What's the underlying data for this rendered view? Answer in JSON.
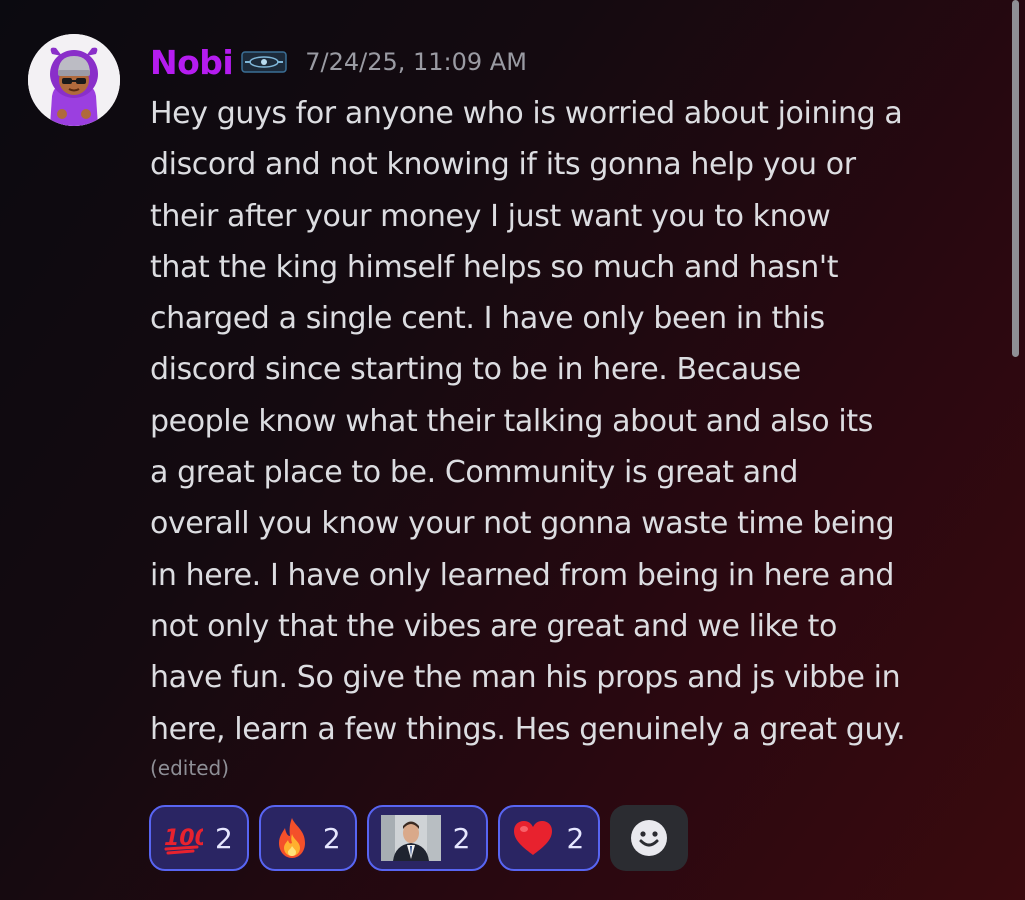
{
  "message": {
    "author": "Nobi",
    "timestamp": "7/24/25, 11:09 AM",
    "lines": [
      "Hey guys for anyone who is worried about joining a",
      "discord and not knowing if its gonna help you or",
      "their after your money I just want you to know",
      "that the king himself helps so much and hasn't",
      "charged a single cent. I have only been in this",
      "discord since starting to be in here. Because",
      "people know what their talking about and also its",
      "a great place to be. Community is great and",
      "overall you know your not gonna waste time being",
      "in here. I have only learned from being in here and",
      "not only that the vibes are great and we like to",
      "have fun. So give the man his props and js vibbe in",
      "here, learn a few things. Hes genuinely a great guy."
    ],
    "edited_label": "(edited)"
  },
  "reactions": [
    {
      "emoji": "hundred-points-icon",
      "count": "2"
    },
    {
      "emoji": "fire-icon",
      "count": "2"
    },
    {
      "emoji": "custom-man-in-suit-icon",
      "count": "2"
    },
    {
      "emoji": "red-heart-icon",
      "count": "2"
    }
  ],
  "add_reaction_icon": "smiley-add-reaction-icon",
  "colors": {
    "username": "#b51cf0",
    "reaction_border": "#5865f2",
    "reaction_bg": "#2a2563"
  }
}
